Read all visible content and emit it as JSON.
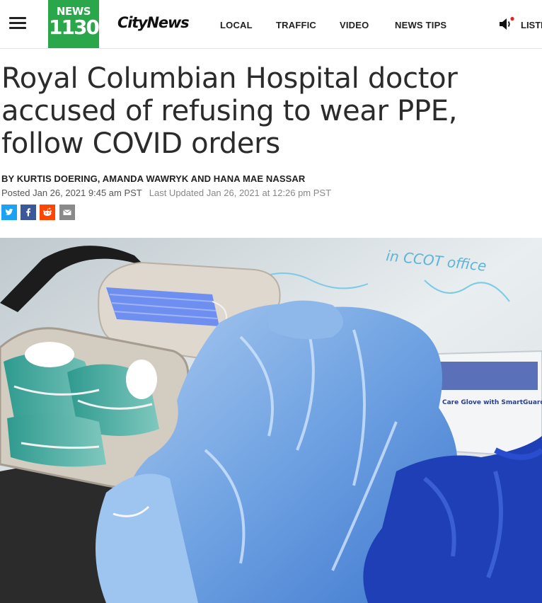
{
  "header": {
    "logo_top": "NEWS",
    "logo_number": "1130",
    "brand": "CityNews",
    "nav": [
      "LOCAL",
      "TRAFFIC",
      "VIDEO",
      "NEWS TIPS"
    ],
    "listen_label": "LISTE",
    "colors": {
      "logo_green": "#2aa64b",
      "live_dot": "#e02424"
    }
  },
  "article": {
    "headline": "Royal Columbian Hospital doctor accused of refusing to wear PPE, follow COVID orders",
    "byline": "BY KURTIS DOERING, AMANDA WAWRYK AND HANA MAE NASSAR",
    "posted": "Posted Jan 26, 2021 9:45 am PST",
    "updated": "Last Updated Jan 26, 2021 at 12:26 pm PST",
    "share_icons": [
      "twitter-icon",
      "facebook-icon",
      "reddit-icon",
      "email-icon"
    ],
    "share_colors": [
      "#1da1f2",
      "#3b5998",
      "#ff4500",
      "#8a8a8a"
    ],
    "photo": {
      "wall_writing": "in CCOT office",
      "glove_box_text": "Care Glove with SmartGuard"
    }
  }
}
